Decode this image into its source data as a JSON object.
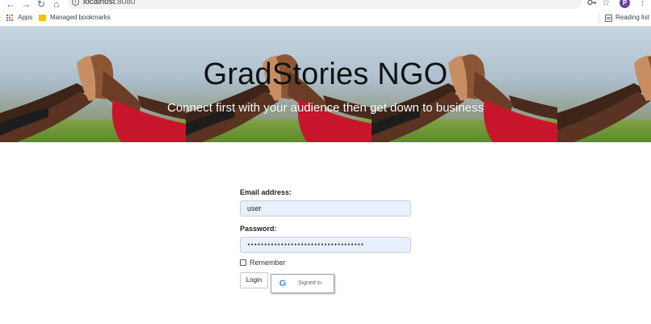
{
  "browser": {
    "url_host": "localhost",
    "url_port": ":8080",
    "profile_initial": "P",
    "bookmarks": {
      "apps_label": "Apps",
      "managed_label": "Managed bookmarks",
      "reading_list_label": "Reading list"
    }
  },
  "hero": {
    "title": "GradStories NGO",
    "subtitle": "Connect first with your audience then get down to business"
  },
  "form": {
    "email_label": "Email address:",
    "email_value": "user",
    "password_label": "Password:",
    "password_value": "•••••••••••••••••••••••••••••••••••",
    "remember_label": "Remember",
    "remember_checked": false,
    "login_label": "Login",
    "google_icon_letter": "G",
    "google_label": "Signed in"
  }
}
